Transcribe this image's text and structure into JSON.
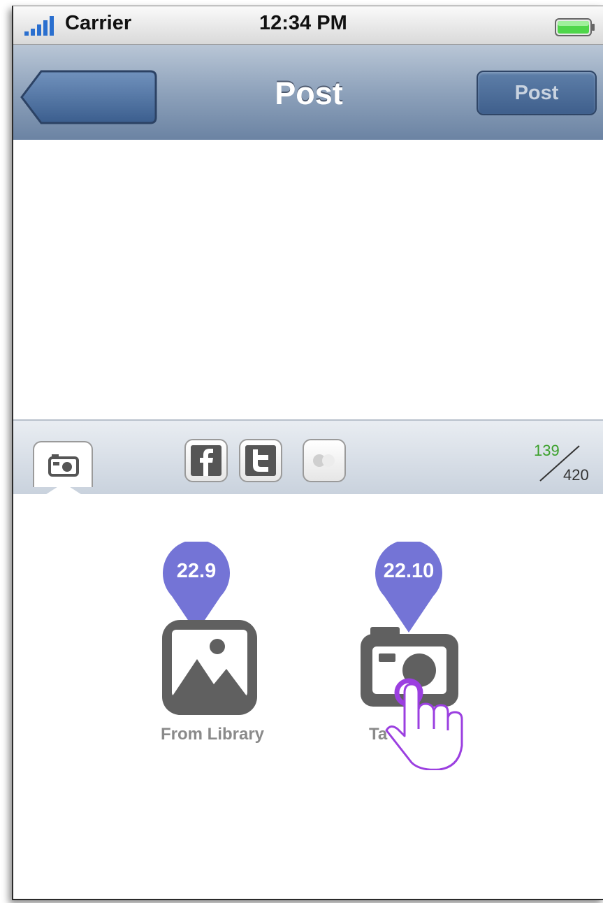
{
  "status_bar": {
    "carrier": "Carrier",
    "time": "12:34 PM",
    "signal_icon": "signal-bars-icon",
    "battery_icon": "battery-icon"
  },
  "nav_bar": {
    "title": "Post",
    "back_label": "",
    "post_button_label": "Post"
  },
  "post_text": "",
  "toolbar": {
    "items": [
      "camera-icon",
      "facebook-icon",
      "twitter-icon",
      "toggle-icon"
    ],
    "counter_current": "139",
    "counter_max": "420"
  },
  "media_options": [
    {
      "label": "From Library",
      "icon": "photo-library-icon",
      "callout": "22.9"
    },
    {
      "label": "Ta",
      "icon": "camera-icon",
      "callout": "22.10"
    }
  ],
  "colors": {
    "nav_bar": "#8ea2bb",
    "post_button": "#3f5f8c",
    "callout": "#7474d6",
    "icon_gray": "#606060",
    "counter_green": "#3aa02a",
    "hand_cursor": "#9b3fe0"
  }
}
